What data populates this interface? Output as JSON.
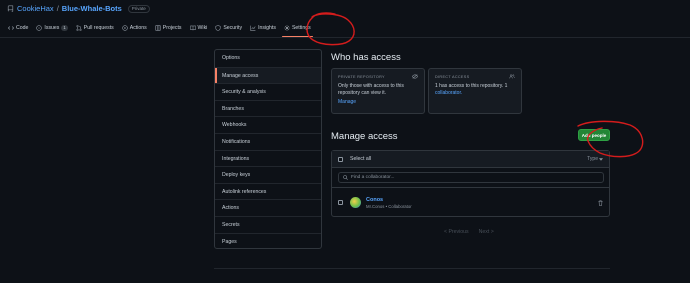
{
  "repo": {
    "owner": "CookieHax",
    "separator": "/",
    "name": "Blue-Whale-Bots",
    "visibility": "Private"
  },
  "tabs": [
    {
      "label": "Code",
      "icon": "code-icon"
    },
    {
      "label": "Issues",
      "icon": "issue-icon",
      "count": "1"
    },
    {
      "label": "Pull requests",
      "icon": "pull-request-icon"
    },
    {
      "label": "Actions",
      "icon": "play-icon"
    },
    {
      "label": "Projects",
      "icon": "table-icon"
    },
    {
      "label": "Wiki",
      "icon": "book-icon"
    },
    {
      "label": "Security",
      "icon": "shield-icon"
    },
    {
      "label": "Insights",
      "icon": "graph-icon"
    },
    {
      "label": "Settings",
      "icon": "gear-icon",
      "active": true
    }
  ],
  "side_menu": [
    "Options",
    "Manage access",
    "Security & analysis",
    "Branches",
    "Webhooks",
    "Notifications",
    "Integrations",
    "Deploy keys",
    "Autolink references",
    "Actions",
    "Secrets",
    "Pages"
  ],
  "who_has_access": {
    "title": "Who has access",
    "private_card": {
      "heading": "PRIVATE REPOSITORY",
      "text": "Only those with access to this repository can view it.",
      "link": "Manage"
    },
    "direct_card": {
      "heading": "DIRECT ACCESS",
      "text": "1 has access to this repository. 1",
      "link": "collaborator."
    }
  },
  "manage_access": {
    "title": "Manage access",
    "add_button": "Add people",
    "select_all": "Select all",
    "type_filter": "Type",
    "search_placeholder": "Find a collaborator...",
    "members": [
      {
        "name": "Conos",
        "subtitle": "Mr.Conos • Collaborator"
      }
    ]
  },
  "pagination": {
    "previous": "< Previous",
    "next": "Next >"
  },
  "colors": {
    "background": "#0d1117",
    "link": "#58a6ff",
    "primary_button": "#238636",
    "active_tab_underline": "#f78166",
    "annotation": "#d41c1c"
  }
}
